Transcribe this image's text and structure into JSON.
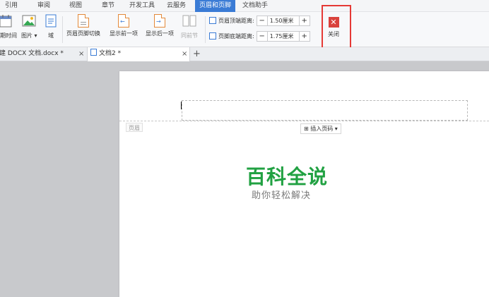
{
  "menu": {
    "items": [
      "引用",
      "审阅",
      "视图",
      "章节",
      "开发工具",
      "云服务",
      "页眉和页脚",
      "文档助手"
    ],
    "active": "页眉和页脚"
  },
  "ribbon": {
    "date_time": "日期时间",
    "picture": "图片",
    "field": "域",
    "switch_header_footer": "页眉页脚切换",
    "show_previous": "显示前一项",
    "show_next": "显示后一项",
    "same_as_previous": "同前节",
    "header_distance_label": "页眉顶端距离:",
    "header_distance_value": "1.50厘米",
    "footer_distance_label": "页脚底端距离:",
    "footer_distance_value": "1.75厘米",
    "minus": "−",
    "plus": "+",
    "close_label": "关闭",
    "close_glyph": "✕",
    "dropdown_glyph": "▾"
  },
  "tabs": [
    {
      "title": "新建 DOCX 文档.docx *",
      "active": false
    },
    {
      "title": "文档2 *",
      "active": true
    }
  ],
  "tab_close": "×",
  "add_tab": "+",
  "document": {
    "header_tag": "页眉",
    "insert_page_number": "插入页码",
    "insert_page_number_icon": "⊞"
  },
  "watermark": {
    "title": "百科全说",
    "subtitle": "助你轻松解决"
  },
  "colors": {
    "active_tab": "#3a7bd5",
    "close_button": "#d9423c",
    "highlight_box": "#e53935",
    "watermark": "#21a142"
  }
}
